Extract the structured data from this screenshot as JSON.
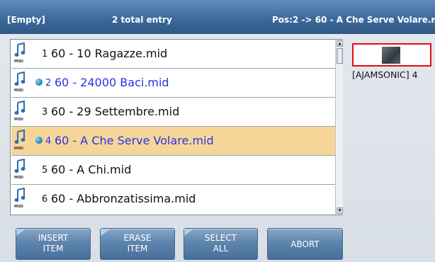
{
  "header": {
    "left": "[Empty]",
    "count": "2 total entry",
    "position": "Pos:2 -> 60 - A Che Serve Volare.mid"
  },
  "list": {
    "icon_caption": "MIDI",
    "items": [
      {
        "index": "1",
        "name": "60 - 10 Ragazze.mid",
        "marked": false,
        "selected": false
      },
      {
        "index": "2",
        "name": "60 - 24000 Baci.mid",
        "marked": true,
        "selected": false
      },
      {
        "index": "3",
        "name": "60 - 29 Settembre.mid",
        "marked": false,
        "selected": false
      },
      {
        "index": "4",
        "name": "60 - A Che Serve Volare.mid",
        "marked": true,
        "selected": true
      },
      {
        "index": "5",
        "name": "60 - A Chi.mid",
        "marked": false,
        "selected": false
      },
      {
        "index": "6",
        "name": "60 - Abbronzatissima.mid",
        "marked": false,
        "selected": false
      }
    ]
  },
  "preview": {
    "label": "[AJAMSONIC] 4"
  },
  "buttons": {
    "insert": [
      "INSERT",
      "ITEM"
    ],
    "erase": [
      "ERASE",
      "ITEM"
    ],
    "select": [
      "SELECT",
      "ALL"
    ],
    "abort": "ABORT"
  },
  "colors": {
    "header": "#3d6a9b",
    "selected_row": "#f6d698",
    "marked_text": "#2b31e6",
    "preview_border": "#e01010",
    "button": "#5e84ad"
  }
}
